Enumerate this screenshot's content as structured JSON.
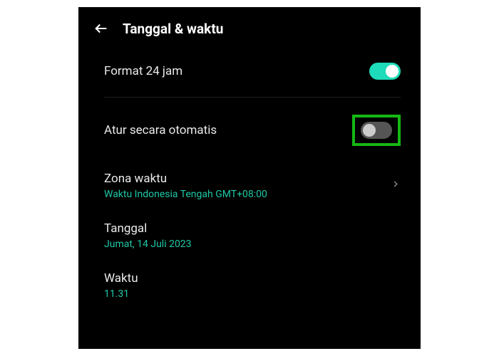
{
  "header": {
    "title": "Tanggal & waktu"
  },
  "rows": {
    "format24": {
      "label": "Format 24 jam"
    },
    "auto": {
      "label": "Atur secara otomatis"
    },
    "timezone": {
      "label": "Zona waktu",
      "value": "Waktu Indonesia Tengah GMT+08:00"
    },
    "date": {
      "label": "Tanggal",
      "value": "Jumat, 14 Juli 2023"
    },
    "time": {
      "label": "Waktu",
      "value": "11.31"
    }
  }
}
